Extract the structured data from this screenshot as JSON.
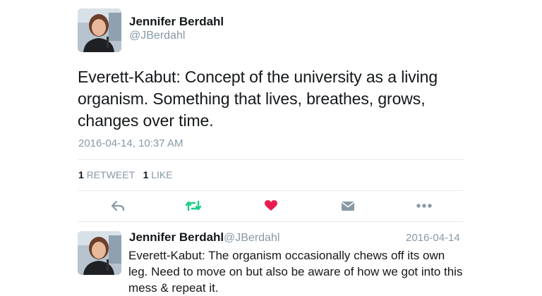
{
  "tweet": {
    "author": {
      "name": "Jennifer Berdahl",
      "handle": "@JBerdahl"
    },
    "text": "Everett-Kabut: Concept of the university as a living organism. Something that lives, breathes, grows, changes over time.",
    "timestamp": "2016-04-14, 10:37 AM",
    "stats": {
      "retweet_count": "1",
      "retweet_label": "RETWEET",
      "like_count": "1",
      "like_label": "LIKE"
    }
  },
  "actions": [
    {
      "name": "reply",
      "icon": "reply-icon",
      "color": "#8899a6"
    },
    {
      "name": "retweet",
      "icon": "retweet-icon",
      "color": "#19cf86"
    },
    {
      "name": "like",
      "icon": "heart-icon",
      "color": "#e81c4f"
    },
    {
      "name": "direct-message",
      "icon": "envelope-icon",
      "color": "#8899a6"
    },
    {
      "name": "more",
      "icon": "more-icon",
      "color": "#8899a6"
    }
  ],
  "reply": {
    "author": {
      "name": "Jennifer Berdahl",
      "handle": "@JBerdahl"
    },
    "date": "2016-04-14",
    "text": "Everett-Kabut: The organism occasionally chews off its own leg. Need to move on but also be aware of how we got into this mess & repeat it."
  }
}
